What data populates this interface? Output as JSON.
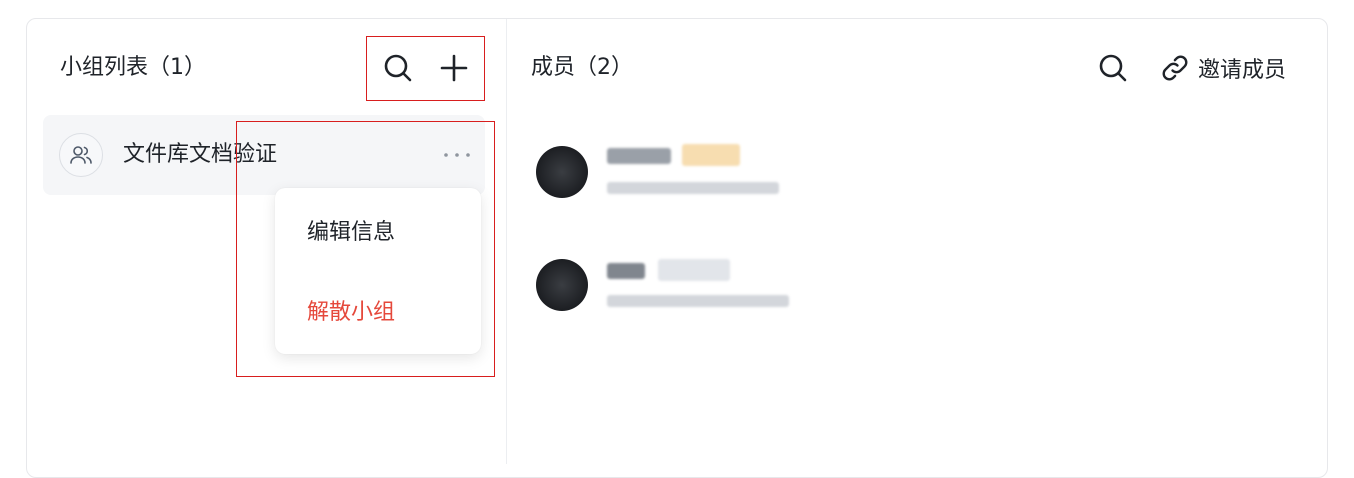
{
  "left_panel": {
    "title": "小组列表（1）",
    "groups": [
      {
        "name": "文件库文档验证"
      }
    ]
  },
  "context_menu": {
    "items": [
      {
        "label": "编辑信息",
        "color": "#1f2329"
      },
      {
        "label": "解散小组",
        "color": "#e5483b"
      }
    ]
  },
  "right_panel": {
    "title": "成员（2）",
    "invite_label": "邀请成员"
  },
  "icons": [
    "search-icon",
    "plus-icon",
    "users-icon",
    "more-icon",
    "link-icon"
  ],
  "colors": {
    "accent_highlight": "#d81e1e",
    "danger": "#e5483b",
    "item_bg": "#f5f6f8"
  }
}
